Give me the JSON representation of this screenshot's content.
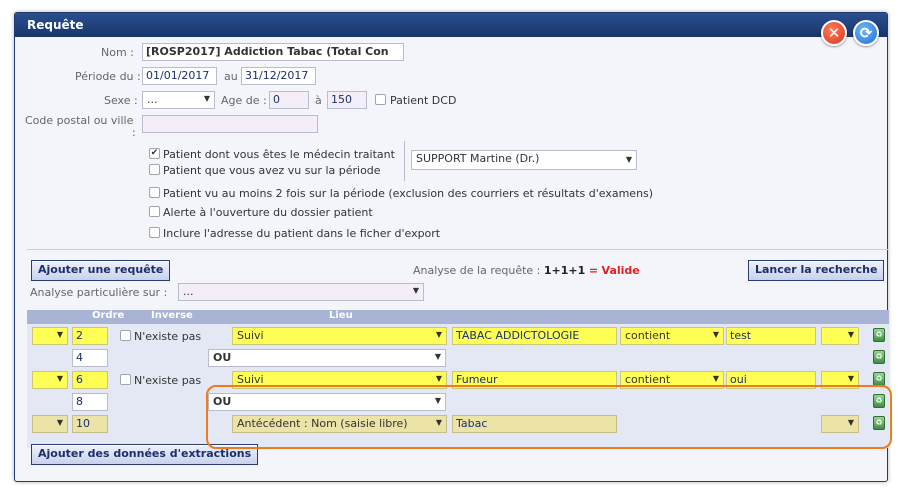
{
  "window": {
    "title": "Requête"
  },
  "form": {
    "nom_label": "Nom :",
    "nom_value": "[ROSP2017] Addiction Tabac (Total Con",
    "periode_du_label": "Période du :",
    "date_from": "01/01/2017",
    "au_label": "au",
    "date_to": "31/12/2017",
    "sexe_label": "Sexe :",
    "sexe_value": "...",
    "age_label": "Age de :",
    "age_from": "0",
    "a_label": "à",
    "age_to": "150",
    "patient_dcd_label": "Patient DCD",
    "code_postal_label_1": "Code postal ou ville",
    "code_postal_label_2": ":",
    "code_postal_value": "",
    "medecin_traitant_label": "Patient dont vous êtes le médecin traitant",
    "vu_periode_label": "Patient que vous avez vu sur la période",
    "doctor_value": "SUPPORT Martine (Dr.)",
    "vu_2fois_label": "Patient vu au moins 2 fois sur la période (exclusion des courriers et résultats d'examens)",
    "alerte_label": "Alerte à l'ouverture du dossier patient",
    "inclure_label": "Inclure l'adresse du patient dans le ficher d'export"
  },
  "actions": {
    "ajouter_requete": "Ajouter une requête",
    "analyse_label": "Analyse de la requête :",
    "analyse_expr": "1+1+1",
    "analyse_eq": "=",
    "analyse_status": "Valide",
    "lancer": "Lancer la recherche",
    "analyse_particuliere_label": "Analyse particulière sur :",
    "analyse_particuliere_value": "...",
    "ajouter_donnees": "Ajouter des données d'extractions"
  },
  "table": {
    "headers": {
      "ordre": "Ordre",
      "inverse": "Inverse",
      "lieu": "Lieu"
    },
    "rows": [
      {
        "ordre": "2",
        "inverse": "N'existe pas",
        "lieu": "Suivi",
        "champ": "TABAC ADDICTOLOGIE",
        "op": "contient",
        "val": "test"
      },
      {
        "ordre": "4",
        "logic": "OU"
      },
      {
        "ordre": "6",
        "inverse": "N'existe pas",
        "lieu": "Suivi",
        "champ": "Fumeur",
        "op": "contient",
        "val": "oui"
      },
      {
        "ordre": "8",
        "logic": "OU"
      },
      {
        "ordre": "10",
        "lieu": "Antécédent : Nom (saisie libre)",
        "champ": "Tabac"
      }
    ]
  },
  "colors": {
    "highlight": "#f07a1e",
    "yellow": "#ffff55",
    "title": "#1f3b70"
  }
}
